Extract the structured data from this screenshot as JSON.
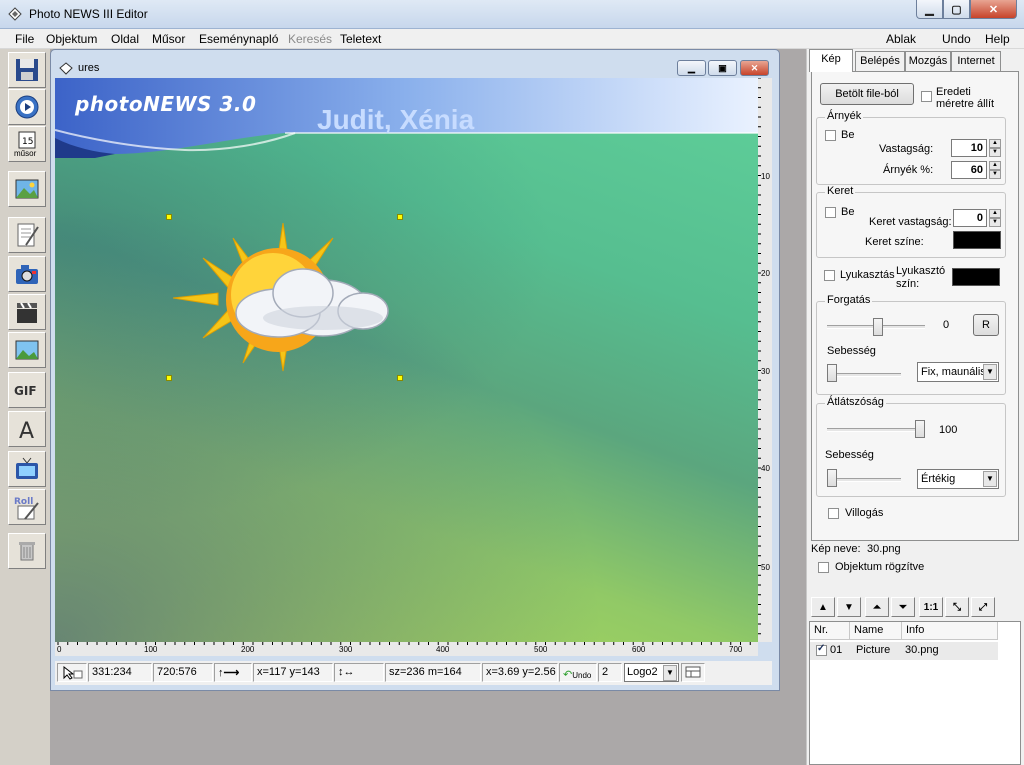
{
  "window": {
    "title": "Photo NEWS III Editor"
  },
  "menu": {
    "items": [
      "File",
      "Objektum",
      "Oldal",
      "Műsor",
      "Eseménynapló",
      "Keresés",
      "Teletext"
    ],
    "right": [
      "Ablak",
      "Undo",
      "Help"
    ]
  },
  "toolbar": {
    "tools": [
      "save-icon",
      "play-icon",
      "calendar-icon",
      "picture-icon",
      "notepad-icon",
      "camera-icon",
      "clapper-icon",
      "landscape-icon",
      "gif-icon",
      "text-icon",
      "tv-icon",
      "roll-icon",
      "trash-icon"
    ],
    "musor_label": "műsor",
    "gif_label": "GIF",
    "text_label": "A",
    "roll_label": "Roll"
  },
  "document": {
    "title": "ures",
    "banner_title": "photoNEWS 3.0",
    "banner_names": "Judit, Xénia"
  },
  "rulers": {
    "horizontal": [
      "0",
      "100",
      "200",
      "300",
      "400",
      "500",
      "600",
      "700"
    ],
    "vertical": [
      "10",
      "20",
      "30",
      "40",
      "50"
    ]
  },
  "status": {
    "pos": "331:234",
    "size": "720:576",
    "xy": "x=117 y=143",
    "sz": "sz=236 m=164",
    "scale": "x=3.69 y=2.56",
    "undo": "Undo",
    "count": "2",
    "layer": "Logo2"
  },
  "panel": {
    "tabs": [
      "Kép",
      "Belépés",
      "Mozgás",
      "Internet"
    ],
    "active_tab": "Kép",
    "load_button": "Betölt file-ból",
    "original_size": "Eredeti méretre állít",
    "shadow": {
      "legend": "Árnyék",
      "on_label": "Be",
      "thickness_label": "Vastagság:",
      "thickness": "10",
      "percent_label": "Árnyék %:",
      "percent": "60"
    },
    "frame": {
      "legend": "Keret",
      "on_label": "Be",
      "thickness_label": "Keret vastagság:",
      "thickness": "0",
      "color_label": "Keret színe:"
    },
    "punch": {
      "label": "Lyukasztás",
      "color_label": "Lyukasztó szín:"
    },
    "rotation": {
      "legend": "Forgatás",
      "value": "0",
      "r_button": "R",
      "speed_label": "Sebesség",
      "speed_select": "Fix, maunális"
    },
    "opacity": {
      "legend": "Átlátszóság",
      "value": "100",
      "speed_label": "Sebesség",
      "speed_select": "Értékig"
    },
    "blink": "Villogás",
    "image_name_label": "Kép neve:",
    "image_name": "30.png",
    "locked_label": "Objektum rögzítve",
    "zoom_label": "1:1",
    "list": {
      "headers": [
        "Nr.",
        "Name",
        "Info"
      ],
      "rows": [
        {
          "nr": "01",
          "name": "Picture",
          "info": "30.png",
          "checked": true
        }
      ]
    }
  }
}
